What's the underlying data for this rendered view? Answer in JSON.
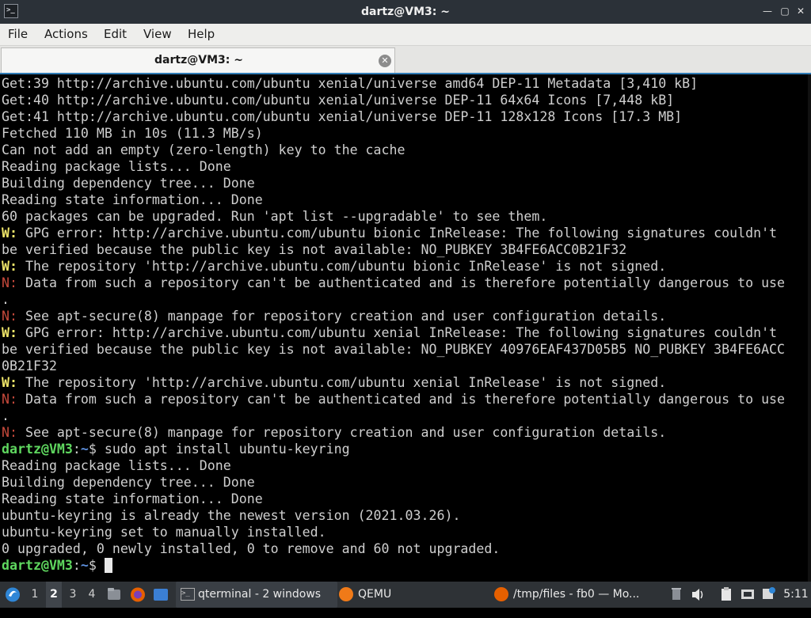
{
  "window": {
    "title": "dartz@VM3: ~"
  },
  "menu": {
    "items": [
      "File",
      "Actions",
      "Edit",
      "View",
      "Help"
    ]
  },
  "tab": {
    "label": "dartz@VM3: ~"
  },
  "terminal": {
    "lines": [
      [
        {
          "t": "Get:39 http://archive.ubuntu.com/ubuntu xenial/universe amd64 DEP-11 Metadata [3,410 kB]"
        }
      ],
      [
        {
          "t": "Get:40 http://archive.ubuntu.com/ubuntu xenial/universe DEP-11 64x64 Icons [7,448 kB]"
        }
      ],
      [
        {
          "t": "Get:41 http://archive.ubuntu.com/ubuntu xenial/universe DEP-11 128x128 Icons [17.3 MB]"
        }
      ],
      [
        {
          "t": "Fetched 110 MB in 10s (11.3 MB/s)"
        }
      ],
      [
        {
          "t": "Can not add an empty (zero-length) key to the cache"
        }
      ],
      [
        {
          "t": "Reading package lists... Done"
        }
      ],
      [
        {
          "t": "Building dependency tree... Done"
        }
      ],
      [
        {
          "t": "Reading state information... Done"
        }
      ],
      [
        {
          "t": "60 packages can be upgraded. Run 'apt list --upgradable' to see them."
        }
      ],
      [
        {
          "t": "W:",
          "c": "warn"
        },
        {
          "t": " GPG error: http://archive.ubuntu.com/ubuntu bionic InRelease: The following signatures couldn't"
        }
      ],
      [
        {
          "t": "be verified because the public key is not available: NO_PUBKEY 3B4FE6ACC0B21F32"
        }
      ],
      [
        {
          "t": "W:",
          "c": "warn"
        },
        {
          "t": " The repository 'http://archive.ubuntu.com/ubuntu bionic InRelease' is not signed."
        }
      ],
      [
        {
          "t": "N:",
          "c": "note"
        },
        {
          "t": " Data from such a repository can't be authenticated and is therefore potentially dangerous to use"
        }
      ],
      [
        {
          "t": "."
        }
      ],
      [
        {
          "t": "N:",
          "c": "note"
        },
        {
          "t": " See apt-secure(8) manpage for repository creation and user configuration details."
        }
      ],
      [
        {
          "t": "W:",
          "c": "warn"
        },
        {
          "t": " GPG error: http://archive.ubuntu.com/ubuntu xenial InRelease: The following signatures couldn't"
        }
      ],
      [
        {
          "t": "be verified because the public key is not available: NO_PUBKEY 40976EAF437D05B5 NO_PUBKEY 3B4FE6ACC"
        }
      ],
      [
        {
          "t": "0B21F32"
        }
      ],
      [
        {
          "t": "W:",
          "c": "warn"
        },
        {
          "t": " The repository 'http://archive.ubuntu.com/ubuntu xenial InRelease' is not signed."
        }
      ],
      [
        {
          "t": "N:",
          "c": "note"
        },
        {
          "t": " Data from such a repository can't be authenticated and is therefore potentially dangerous to use"
        }
      ],
      [
        {
          "t": "."
        }
      ],
      [
        {
          "t": "N:",
          "c": "note"
        },
        {
          "t": " See apt-secure(8) manpage for repository creation and user configuration details."
        }
      ],
      [
        {
          "t": "dartz@VM3",
          "c": "pu"
        },
        {
          "t": ":"
        },
        {
          "t": "~",
          "c": "pp"
        },
        {
          "t": "$ sudo apt install ubuntu-keyring"
        }
      ],
      [
        {
          "t": "Reading package lists... Done"
        }
      ],
      [
        {
          "t": "Building dependency tree... Done"
        }
      ],
      [
        {
          "t": "Reading state information... Done"
        }
      ],
      [
        {
          "t": "ubuntu-keyring is already the newest version (2021.03.26)."
        }
      ],
      [
        {
          "t": "ubuntu-keyring set to manually installed."
        }
      ],
      [
        {
          "t": "0 upgraded, 0 newly installed, 0 to remove and 60 not upgraded."
        }
      ],
      [
        {
          "t": "dartz@VM3",
          "c": "pu"
        },
        {
          "t": ":"
        },
        {
          "t": "~",
          "c": "pp"
        },
        {
          "t": "$ "
        },
        {
          "cursor": true
        }
      ]
    ]
  },
  "taskbar": {
    "workspaces": [
      "1",
      "2",
      "3",
      "4"
    ],
    "active_workspace": "2",
    "tasks": [
      "qterminal - 2 windows",
      "QEMU",
      "/tmp/files - fb0 — Mo..."
    ],
    "clock": "5:11"
  },
  "colors": {
    "warn": "#f0e66a",
    "note": "#c5493b",
    "prompt_user": "#5fd75f",
    "prompt_path": "#5d8fdc",
    "terminal_bg": "#000000",
    "terminal_fg": "#cfcfcf"
  }
}
